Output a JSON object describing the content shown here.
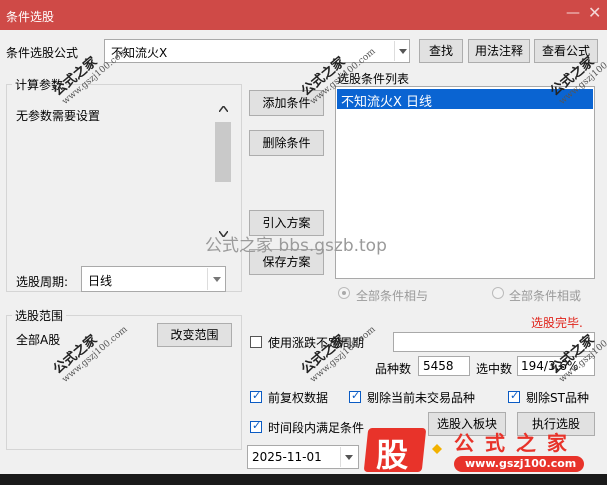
{
  "window": {
    "title": "条件选股",
    "minimize_glyph": "—",
    "close_glyph": "✕"
  },
  "formula": {
    "label": "条件选股公式",
    "value": "不知流火X",
    "search_button": "查找",
    "usage_button": "用法注释",
    "view_button": "查看公式"
  },
  "params": {
    "legend": "计算参数",
    "message": "无参数需要设置"
  },
  "period": {
    "label": "选股周期:",
    "value": "日线"
  },
  "conditions": {
    "legend": "选股条件列表",
    "items": [
      "不知流火X  日线"
    ],
    "add_button": "添加条件",
    "delete_button": "删除条件",
    "import_button": "引入方案",
    "save_button": "保存方案",
    "and_label": "全部条件相与",
    "or_label": "全部条件相或"
  },
  "scope": {
    "legend": "选股范围",
    "value": "全部A股",
    "change_button": "改变范围"
  },
  "status_text": "选股完毕.",
  "custom_period": {
    "label": "使用涨跌不定周期",
    "checked": false
  },
  "counts": {
    "total_label": "品种数",
    "total_value": "5458",
    "selected_label": "选中数",
    "selected_value": "194/3.6%"
  },
  "options": {
    "adjusted": "前复权数据",
    "exclude_untraded": "剔除当前未交易品种",
    "exclude_st": "剔除ST品种",
    "time_range": "时间段内满足条件",
    "date_value": "2025-11-01"
  },
  "actions": {
    "to_block": "选股入板块",
    "execute": "执行选股"
  },
  "watermark": {
    "center": "公式之家 bbs.gszb.top",
    "logo_char": "股",
    "logo_title": "公 式 之 家",
    "logo_url": "www.gszj100.com",
    "stamp_title": "公式之家",
    "stamp_url": "www.gszj100.com"
  },
  "colors": {
    "titlebar": "#cf4a47",
    "selection": "#0a64d2",
    "status": "#e0241b"
  }
}
